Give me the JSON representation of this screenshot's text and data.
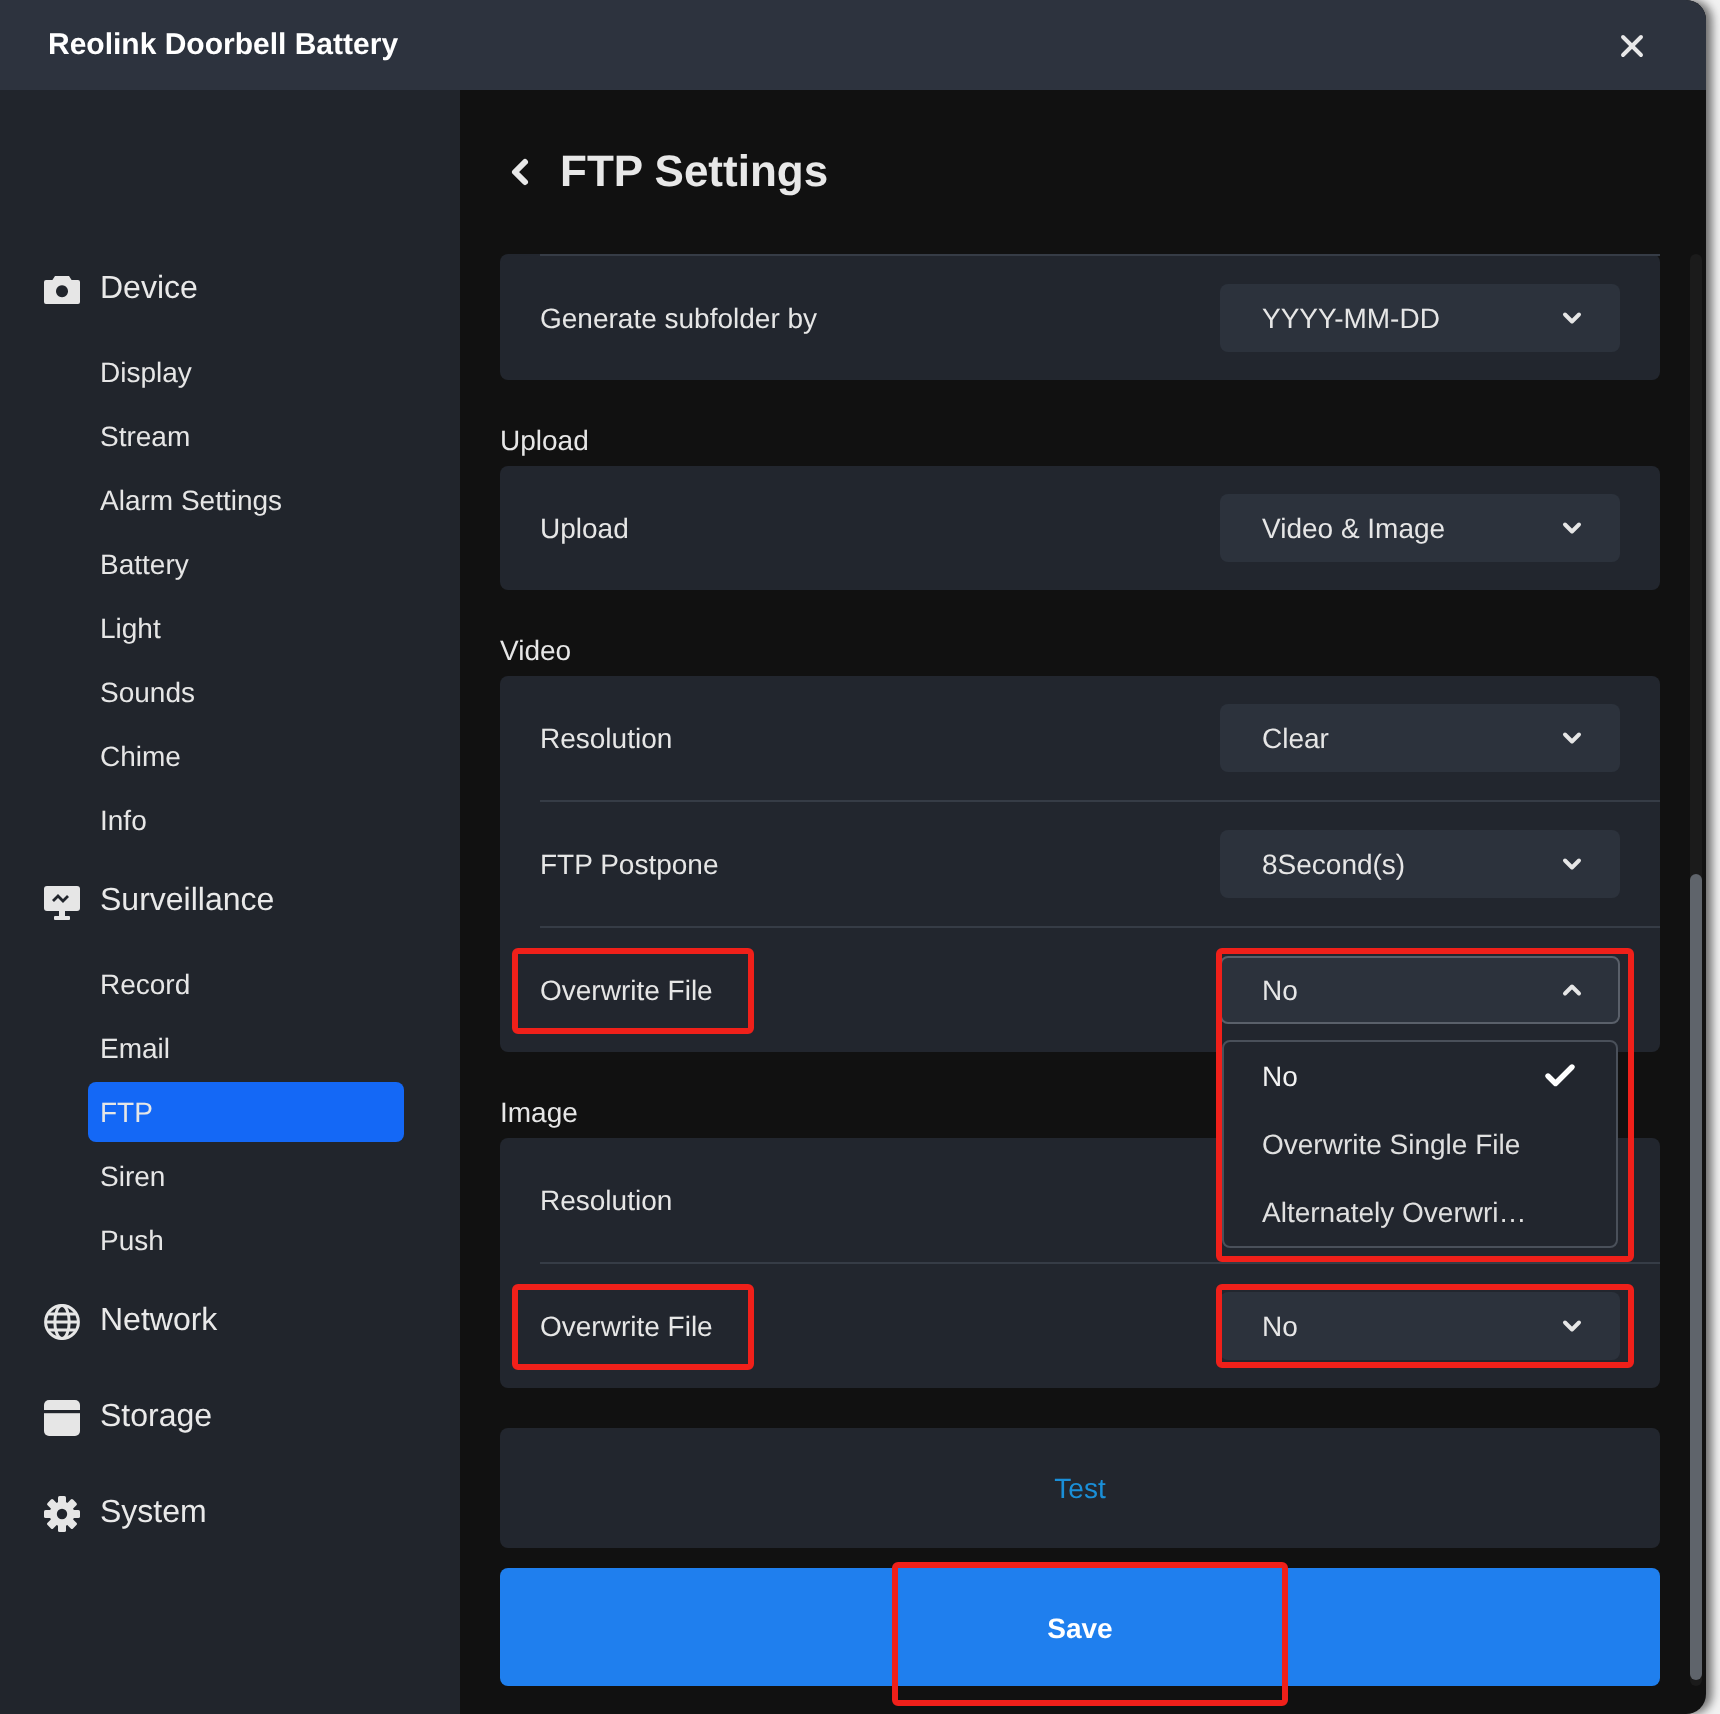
{
  "window": {
    "title": "Reolink Doorbell Battery"
  },
  "sidebar": {
    "groups": [
      {
        "label": "Device",
        "items": [
          {
            "label": "Display",
            "selected": false
          },
          {
            "label": "Stream",
            "selected": false
          },
          {
            "label": "Alarm Settings",
            "selected": false
          },
          {
            "label": "Battery",
            "selected": false
          },
          {
            "label": "Light",
            "selected": false
          },
          {
            "label": "Sounds",
            "selected": false
          },
          {
            "label": "Chime",
            "selected": false
          },
          {
            "label": "Info",
            "selected": false
          }
        ]
      },
      {
        "label": "Surveillance",
        "items": [
          {
            "label": "Record",
            "selected": false
          },
          {
            "label": "Email",
            "selected": false
          },
          {
            "label": "FTP",
            "selected": true
          },
          {
            "label": "Siren",
            "selected": false
          },
          {
            "label": "Push",
            "selected": false
          }
        ]
      },
      {
        "label": "Network"
      },
      {
        "label": "Storage"
      },
      {
        "label": "System"
      }
    ]
  },
  "page": {
    "title": "FTP Settings"
  },
  "sections": [
    {
      "rows": [
        {
          "label": "Generate subfolder by",
          "value": "YYYY-MM-DD",
          "expanded": false,
          "highlighted": false
        }
      ]
    },
    {
      "heading": "Upload",
      "rows": [
        {
          "label": "Upload",
          "value": "Video & Image",
          "expanded": false,
          "highlighted": false
        }
      ]
    },
    {
      "heading": "Video",
      "rows": [
        {
          "label": "Resolution",
          "value": "Clear",
          "expanded": false,
          "highlighted": false
        },
        {
          "label": "FTP Postpone",
          "value": "8Second(s)",
          "expanded": false,
          "highlighted": false
        },
        {
          "label": "Overwrite File",
          "value": "No",
          "expanded": true,
          "highlighted": true,
          "options": [
            {
              "label": "No",
              "selected": true
            },
            {
              "label": "Overwrite Single File",
              "selected": false
            },
            {
              "label": "Alternately Overwri…",
              "selected": false
            }
          ]
        }
      ]
    },
    {
      "heading": "Image",
      "rows": [
        {
          "label": "Resolution",
          "highlighted": false
        },
        {
          "label": "Overwrite File",
          "value": "No",
          "expanded": false,
          "highlighted": true
        }
      ]
    }
  ],
  "test_button": {
    "label": "Test"
  },
  "save_button": {
    "label": "Save",
    "highlighted": true
  }
}
